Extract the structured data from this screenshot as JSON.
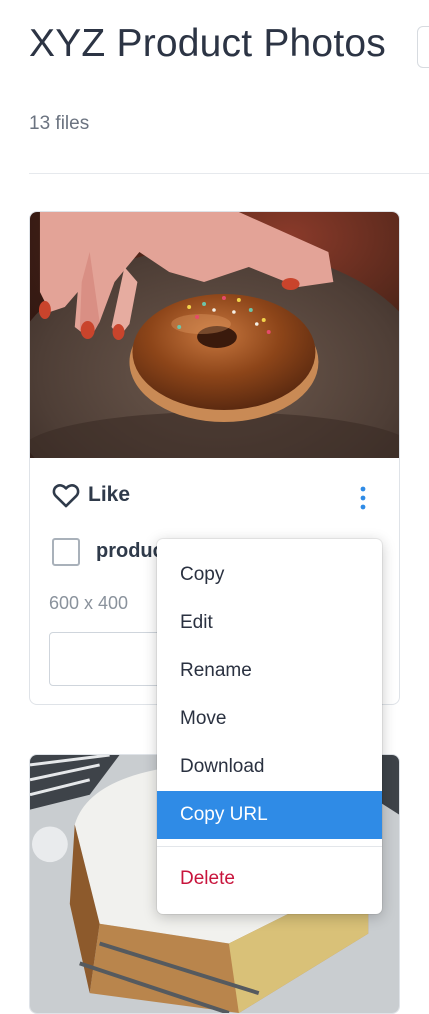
{
  "header": {
    "title": "XYZ Product Photos",
    "file_count": "13 files"
  },
  "card": {
    "like_label": "Like",
    "filename": "produc",
    "dimensions": "600 x 400"
  },
  "context_menu": {
    "items": [
      {
        "label": "Copy"
      },
      {
        "label": "Edit"
      },
      {
        "label": "Rename"
      },
      {
        "label": "Move"
      },
      {
        "label": "Download"
      },
      {
        "label": "Copy URL",
        "state": "highlighted"
      },
      {
        "label": "Delete",
        "style": "danger"
      }
    ]
  },
  "colors": {
    "accent": "#2f8be6",
    "danger": "#c8143c",
    "kebab": "#2f8be6"
  },
  "icons": {
    "like": "heart-outline-icon",
    "more": "vertical-ellipsis-icon"
  }
}
